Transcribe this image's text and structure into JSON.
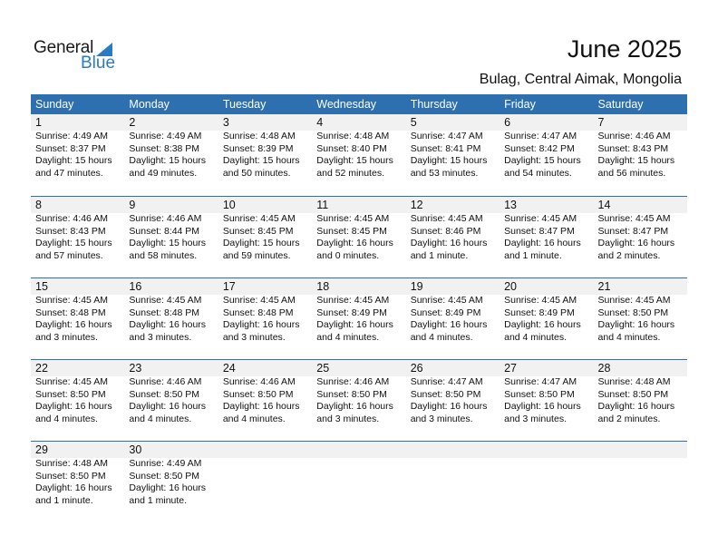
{
  "logo": {
    "general": "General",
    "blue": "Blue",
    "accent_color": "#2a7bc4"
  },
  "header": {
    "title": "June 2025",
    "location": "Bulag, Central Aimak, Mongolia"
  },
  "calendar": {
    "header_color": "#2e6fb0",
    "weekdays": [
      "Sunday",
      "Monday",
      "Tuesday",
      "Wednesday",
      "Thursday",
      "Friday",
      "Saturday"
    ],
    "weeks": [
      [
        {
          "day": "1",
          "sunrise": "Sunrise: 4:49 AM",
          "sunset": "Sunset: 8:37 PM",
          "daylight": "Daylight: 15 hours",
          "daylight2": "and 47 minutes."
        },
        {
          "day": "2",
          "sunrise": "Sunrise: 4:49 AM",
          "sunset": "Sunset: 8:38 PM",
          "daylight": "Daylight: 15 hours",
          "daylight2": "and 49 minutes."
        },
        {
          "day": "3",
          "sunrise": "Sunrise: 4:48 AM",
          "sunset": "Sunset: 8:39 PM",
          "daylight": "Daylight: 15 hours",
          "daylight2": "and 50 minutes."
        },
        {
          "day": "4",
          "sunrise": "Sunrise: 4:48 AM",
          "sunset": "Sunset: 8:40 PM",
          "daylight": "Daylight: 15 hours",
          "daylight2": "and 52 minutes."
        },
        {
          "day": "5",
          "sunrise": "Sunrise: 4:47 AM",
          "sunset": "Sunset: 8:41 PM",
          "daylight": "Daylight: 15 hours",
          "daylight2": "and 53 minutes."
        },
        {
          "day": "6",
          "sunrise": "Sunrise: 4:47 AM",
          "sunset": "Sunset: 8:42 PM",
          "daylight": "Daylight: 15 hours",
          "daylight2": "and 54 minutes."
        },
        {
          "day": "7",
          "sunrise": "Sunrise: 4:46 AM",
          "sunset": "Sunset: 8:43 PM",
          "daylight": "Daylight: 15 hours",
          "daylight2": "and 56 minutes."
        }
      ],
      [
        {
          "day": "8",
          "sunrise": "Sunrise: 4:46 AM",
          "sunset": "Sunset: 8:43 PM",
          "daylight": "Daylight: 15 hours",
          "daylight2": "and 57 minutes."
        },
        {
          "day": "9",
          "sunrise": "Sunrise: 4:46 AM",
          "sunset": "Sunset: 8:44 PM",
          "daylight": "Daylight: 15 hours",
          "daylight2": "and 58 minutes."
        },
        {
          "day": "10",
          "sunrise": "Sunrise: 4:45 AM",
          "sunset": "Sunset: 8:45 PM",
          "daylight": "Daylight: 15 hours",
          "daylight2": "and 59 minutes."
        },
        {
          "day": "11",
          "sunrise": "Sunrise: 4:45 AM",
          "sunset": "Sunset: 8:45 PM",
          "daylight": "Daylight: 16 hours",
          "daylight2": "and 0 minutes."
        },
        {
          "day": "12",
          "sunrise": "Sunrise: 4:45 AM",
          "sunset": "Sunset: 8:46 PM",
          "daylight": "Daylight: 16 hours",
          "daylight2": "and 1 minute."
        },
        {
          "day": "13",
          "sunrise": "Sunrise: 4:45 AM",
          "sunset": "Sunset: 8:47 PM",
          "daylight": "Daylight: 16 hours",
          "daylight2": "and 1 minute."
        },
        {
          "day": "14",
          "sunrise": "Sunrise: 4:45 AM",
          "sunset": "Sunset: 8:47 PM",
          "daylight": "Daylight: 16 hours",
          "daylight2": "and 2 minutes."
        }
      ],
      [
        {
          "day": "15",
          "sunrise": "Sunrise: 4:45 AM",
          "sunset": "Sunset: 8:48 PM",
          "daylight": "Daylight: 16 hours",
          "daylight2": "and 3 minutes."
        },
        {
          "day": "16",
          "sunrise": "Sunrise: 4:45 AM",
          "sunset": "Sunset: 8:48 PM",
          "daylight": "Daylight: 16 hours",
          "daylight2": "and 3 minutes."
        },
        {
          "day": "17",
          "sunrise": "Sunrise: 4:45 AM",
          "sunset": "Sunset: 8:48 PM",
          "daylight": "Daylight: 16 hours",
          "daylight2": "and 3 minutes."
        },
        {
          "day": "18",
          "sunrise": "Sunrise: 4:45 AM",
          "sunset": "Sunset: 8:49 PM",
          "daylight": "Daylight: 16 hours",
          "daylight2": "and 4 minutes."
        },
        {
          "day": "19",
          "sunrise": "Sunrise: 4:45 AM",
          "sunset": "Sunset: 8:49 PM",
          "daylight": "Daylight: 16 hours",
          "daylight2": "and 4 minutes."
        },
        {
          "day": "20",
          "sunrise": "Sunrise: 4:45 AM",
          "sunset": "Sunset: 8:49 PM",
          "daylight": "Daylight: 16 hours",
          "daylight2": "and 4 minutes."
        },
        {
          "day": "21",
          "sunrise": "Sunrise: 4:45 AM",
          "sunset": "Sunset: 8:50 PM",
          "daylight": "Daylight: 16 hours",
          "daylight2": "and 4 minutes."
        }
      ],
      [
        {
          "day": "22",
          "sunrise": "Sunrise: 4:45 AM",
          "sunset": "Sunset: 8:50 PM",
          "daylight": "Daylight: 16 hours",
          "daylight2": "and 4 minutes."
        },
        {
          "day": "23",
          "sunrise": "Sunrise: 4:46 AM",
          "sunset": "Sunset: 8:50 PM",
          "daylight": "Daylight: 16 hours",
          "daylight2": "and 4 minutes."
        },
        {
          "day": "24",
          "sunrise": "Sunrise: 4:46 AM",
          "sunset": "Sunset: 8:50 PM",
          "daylight": "Daylight: 16 hours",
          "daylight2": "and 4 minutes."
        },
        {
          "day": "25",
          "sunrise": "Sunrise: 4:46 AM",
          "sunset": "Sunset: 8:50 PM",
          "daylight": "Daylight: 16 hours",
          "daylight2": "and 3 minutes."
        },
        {
          "day": "26",
          "sunrise": "Sunrise: 4:47 AM",
          "sunset": "Sunset: 8:50 PM",
          "daylight": "Daylight: 16 hours",
          "daylight2": "and 3 minutes."
        },
        {
          "day": "27",
          "sunrise": "Sunrise: 4:47 AM",
          "sunset": "Sunset: 8:50 PM",
          "daylight": "Daylight: 16 hours",
          "daylight2": "and 3 minutes."
        },
        {
          "day": "28",
          "sunrise": "Sunrise: 4:48 AM",
          "sunset": "Sunset: 8:50 PM",
          "daylight": "Daylight: 16 hours",
          "daylight2": "and 2 minutes."
        }
      ],
      [
        {
          "day": "29",
          "sunrise": "Sunrise: 4:48 AM",
          "sunset": "Sunset: 8:50 PM",
          "daylight": "Daylight: 16 hours",
          "daylight2": "and 1 minute."
        },
        {
          "day": "30",
          "sunrise": "Sunrise: 4:49 AM",
          "sunset": "Sunset: 8:50 PM",
          "daylight": "Daylight: 16 hours",
          "daylight2": "and 1 minute."
        },
        null,
        null,
        null,
        null,
        null
      ]
    ]
  }
}
